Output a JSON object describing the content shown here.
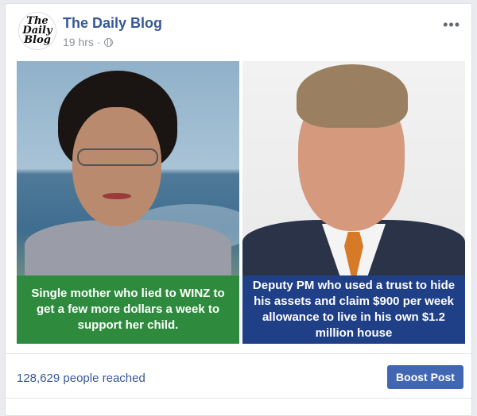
{
  "post": {
    "page_name": "The Daily Blog",
    "avatar_text": [
      "The",
      "Daily",
      "Blog"
    ],
    "time": "19 hrs",
    "separator": "·",
    "more_label": "•••"
  },
  "image": {
    "left_caption": "Single mother who lied to WINZ to get a few more dollars a week to support her child.",
    "right_caption": "Deputy PM who used a trust to hide his assets and claim $900 per week allowance to live in his own $1.2 million house"
  },
  "footer": {
    "reach": "128,629 people reached",
    "boost_label": "Boost Post"
  },
  "colors": {
    "link": "#365899",
    "boost": "#4267b2",
    "caption_left": "#2e8b3d",
    "caption_right": "#1f3f86"
  }
}
